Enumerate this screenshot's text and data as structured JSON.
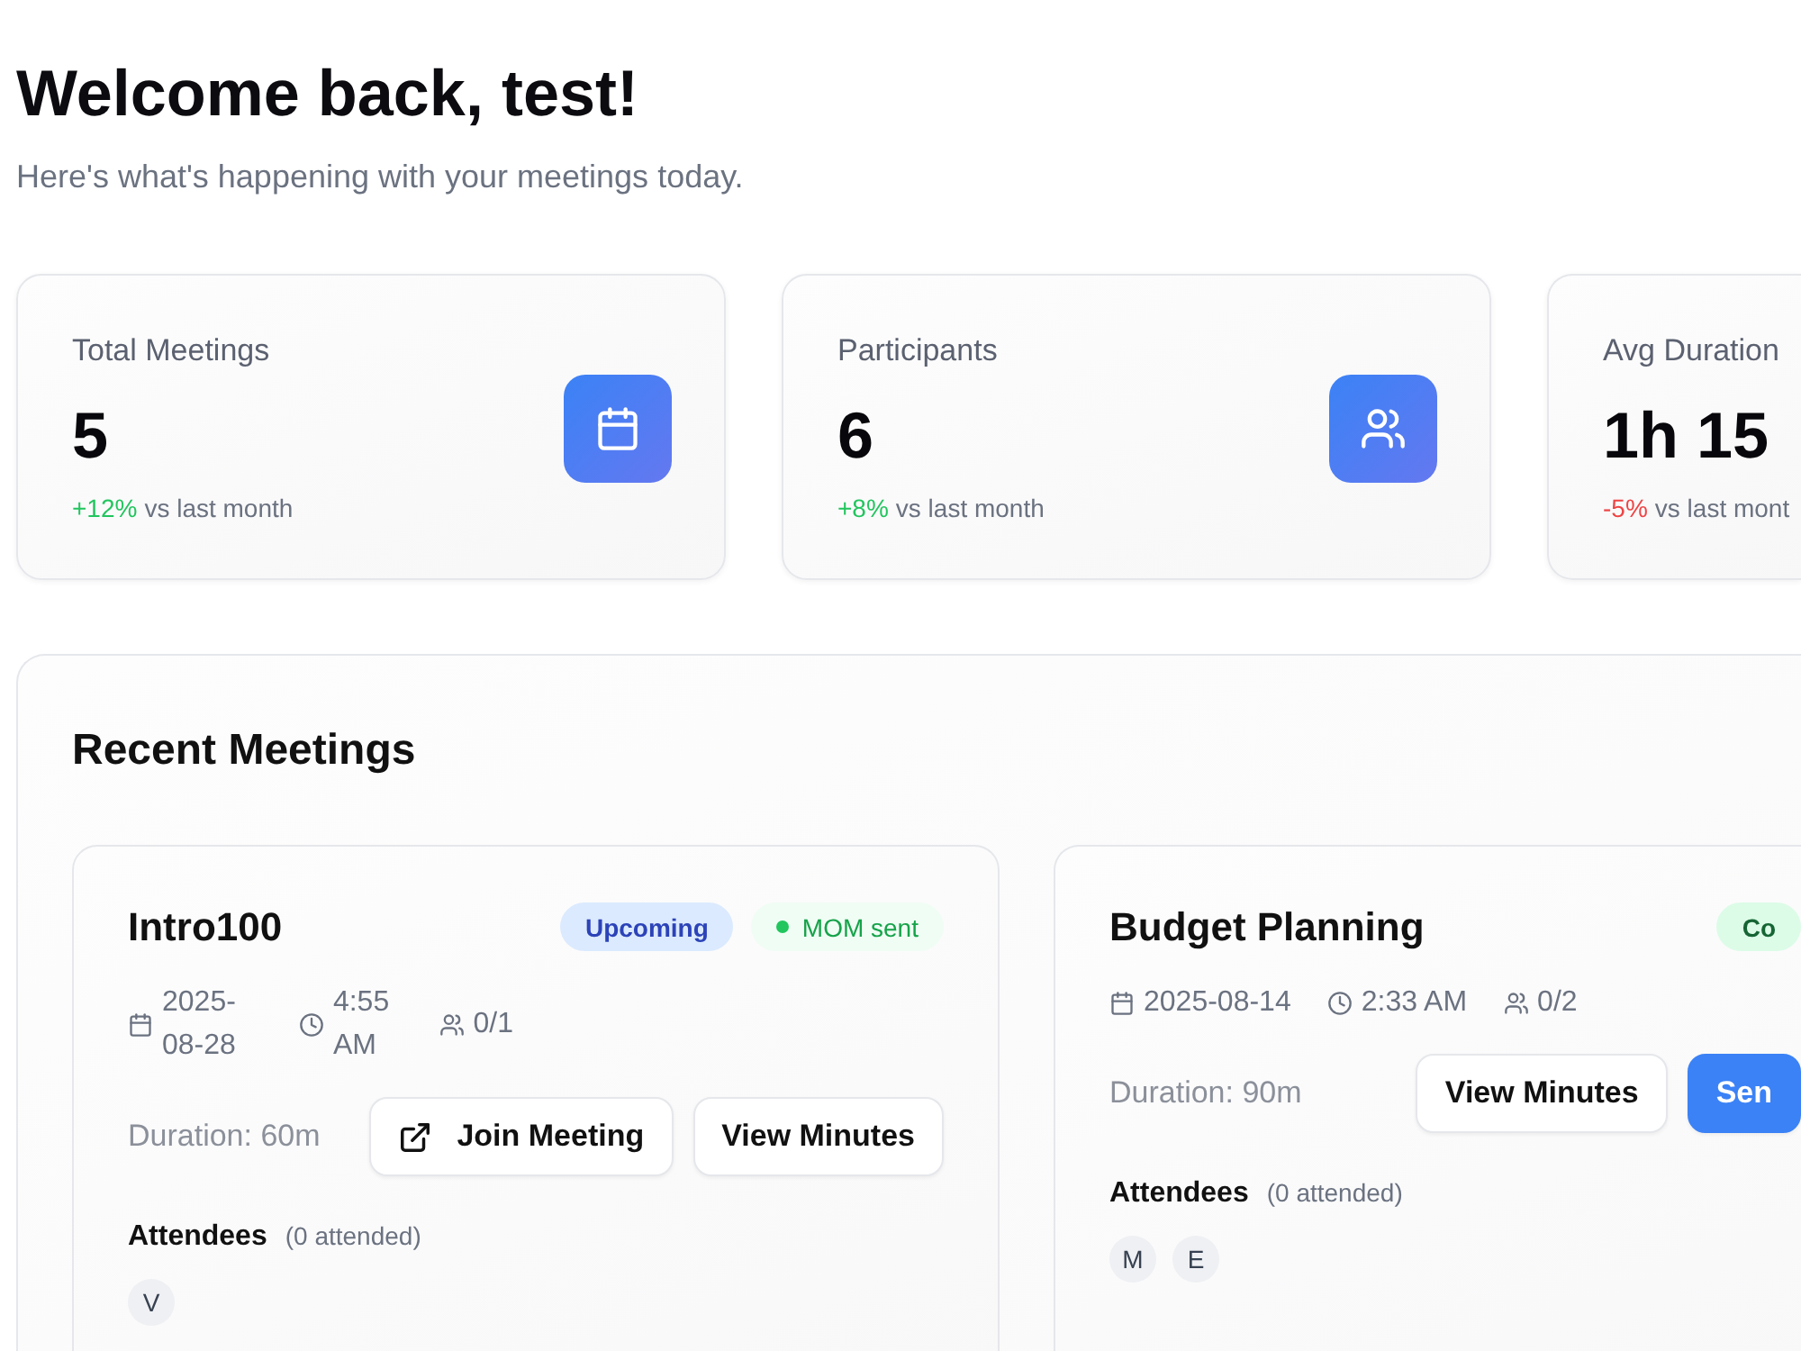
{
  "header": {
    "title": "Welcome back, test!",
    "subtitle": "Here's what's happening with your meetings today."
  },
  "stats": [
    {
      "kind": "meetings",
      "label": "Total Meetings",
      "value": "5",
      "change": "+12%",
      "color": "#22c55e",
      "note": "vs last month"
    },
    {
      "kind": "participants",
      "label": "Participants",
      "value": "6",
      "change": "+8%",
      "color": "#22c55e",
      "note": "vs last month"
    },
    {
      "label": "Avg Duration",
      "value": "1h 15",
      "change": "-5%",
      "color": "#ef4444",
      "note": "vs last mont"
    }
  ],
  "recent": {
    "title": "Recent Meetings",
    "meetings": [
      {
        "title": "Intro100",
        "badges": [
          {
            "label": "Upcoming",
            "kind": "upcoming"
          },
          {
            "label": "MOM sent",
            "kind": "mom"
          }
        ],
        "date": "2025-08-28",
        "time": "4:55 AM",
        "attendance": "0/1",
        "duration": "Duration: 60m",
        "actions": [
          {
            "label": "Join Meeting",
            "kind": "join"
          },
          {
            "label": "View Minutes",
            "kind": "minutes"
          }
        ],
        "attendees_label": "Attendees",
        "attended": "(0 attended)",
        "attendees": [
          "V"
        ]
      },
      {
        "title": "Budget Planning",
        "badges": [
          {
            "label": "Co",
            "kind": "completed"
          }
        ],
        "date": "2025-08-14",
        "time": "2:33 AM",
        "attendance": "0/2",
        "duration": "Duration: 90m",
        "actions": [
          {
            "label": "View Minutes",
            "kind": "minutes"
          },
          {
            "label": "Sen",
            "kind": "send"
          }
        ],
        "attendees_label": "Attendees",
        "attended": "(0 attended)",
        "attendees": [
          "M",
          "E"
        ]
      }
    ]
  }
}
